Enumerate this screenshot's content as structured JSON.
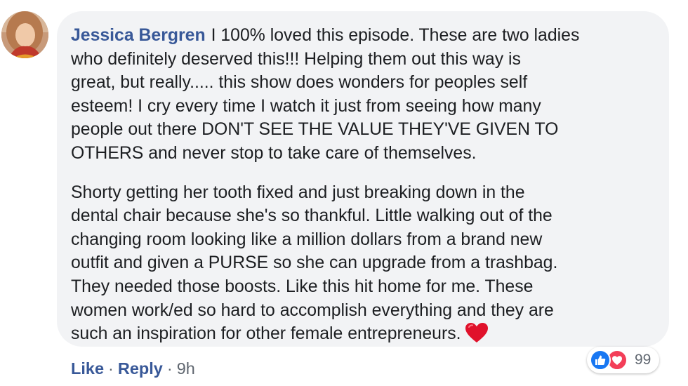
{
  "comment": {
    "author": "Jessica Bergren",
    "paragraph1": [
      "I 100% loved this episode. These are two ladies",
      "who definitely deserved this!!! Helping them out this way is",
      "great, but really..... this show does wonders for peoples self",
      "esteem! I cry every time I watch it just from seeing how many",
      "people out there DON'T SEE THE VALUE THEY'VE GIVEN TO",
      "OTHERS and never stop to take care of themselves."
    ],
    "paragraph2": [
      "Shorty getting her tooth fixed and just breaking down in the",
      "dental chair because she's so thankful. Little walking out of the",
      "changing room looking like a million dollars from a brand new",
      "outfit and given a PURSE so she can upgrade from a trashbag.",
      "They needed those boosts. Like this hit home for me. These",
      "women work/ed so hard to accomplish everything and they are",
      "such an inspiration for other female entrepreneurs."
    ],
    "emoji": "red-heart-emoji",
    "reactions": {
      "icons": [
        "like-icon",
        "love-icon"
      ],
      "count": "99",
      "like_color": "#1877f2",
      "love_color": "#f33e58"
    },
    "actions": {
      "like_label": "Like",
      "separator": "·",
      "reply_label": "Reply",
      "timestamp": "9h"
    }
  },
  "colors": {
    "bubble_bg": "#f2f3f5",
    "author_link": "#385898",
    "text": "#1c1e21",
    "meta": "#606770"
  }
}
